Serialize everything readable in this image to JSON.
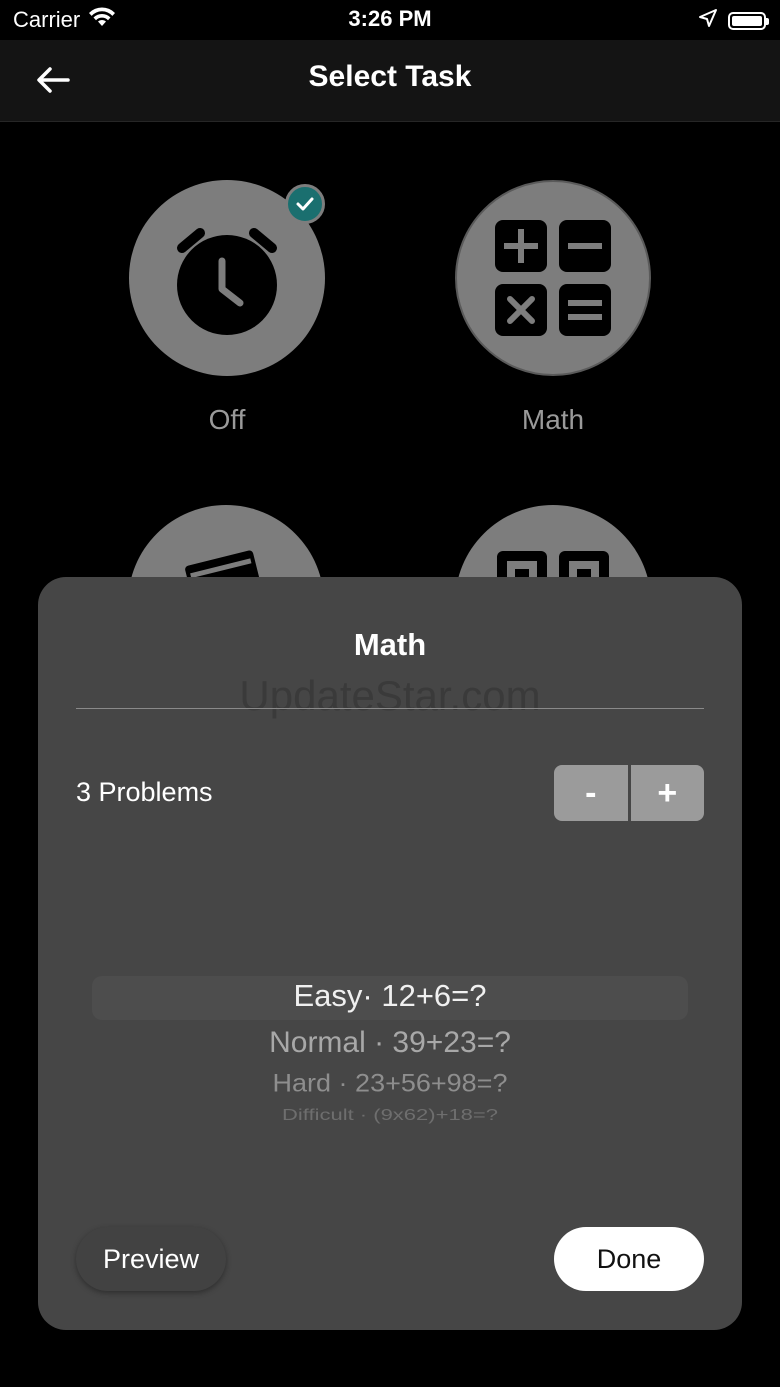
{
  "status": {
    "carrier": "Carrier",
    "time": "3:26 PM"
  },
  "nav": {
    "title": "Select Task"
  },
  "tasks": [
    {
      "label": "Off",
      "icon": "alarm-clock-icon",
      "selected": true
    },
    {
      "label": "Math",
      "icon": "calculator-icon",
      "selected": false
    }
  ],
  "sheet": {
    "title": "Math",
    "watermark": "UpdateStar.com",
    "problems_label": "3 Problems",
    "stepper": {
      "minus": "-",
      "plus": "+"
    },
    "difficulty_options": [
      "Easy· 12+6=?",
      "Normal · 39+23=?",
      "Hard · 23+56+98=?",
      "Difficult · (9x62)+18=?"
    ],
    "preview_label": "Preview",
    "done_label": "Done"
  },
  "colors": {
    "accent": "#1a6f6f",
    "tile": "#7d7d7d",
    "sheet": "#464646"
  }
}
